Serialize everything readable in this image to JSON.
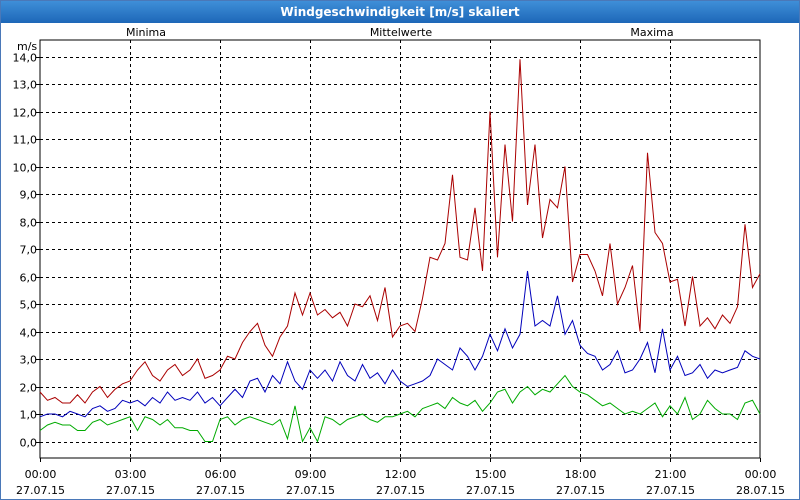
{
  "chart_data": {
    "type": "line",
    "title": "Windgeschwindigkeit [m/s] skaliert",
    "ylabel": "m/s",
    "ylim": [
      -0.6,
      14.6
    ],
    "xlim": [
      0,
      24
    ],
    "yticks": [
      "0,0",
      "1,0",
      "2,0",
      "3,0",
      "4,0",
      "5,0",
      "6,0",
      "7,0",
      "8,0",
      "9,0",
      "10,0",
      "11,0",
      "12,0",
      "13,0",
      "14,0"
    ],
    "xticks": [
      {
        "time": "00:00",
        "date": "27.07.15"
      },
      {
        "time": "03:00",
        "date": "27.07.15"
      },
      {
        "time": "06:00",
        "date": "27.07.15"
      },
      {
        "time": "09:00",
        "date": "27.07.15"
      },
      {
        "time": "12:00",
        "date": "27.07.15"
      },
      {
        "time": "15:00",
        "date": "27.07.15"
      },
      {
        "time": "18:00",
        "date": "27.07.15"
      },
      {
        "time": "21:00",
        "date": "27.07.15"
      },
      {
        "time": "00:00",
        "date": "28.07.15"
      }
    ],
    "grid": true,
    "legend_position": "top",
    "series": [
      {
        "name": "Minima",
        "color": "#00aa00",
        "x": [
          0,
          0.25,
          0.5,
          0.75,
          1,
          1.25,
          1.5,
          1.75,
          2,
          2.25,
          2.5,
          2.75,
          3,
          3.25,
          3.5,
          3.75,
          4,
          4.25,
          4.5,
          4.75,
          5,
          5.25,
          5.5,
          5.75,
          6,
          6.25,
          6.5,
          6.75,
          7,
          7.25,
          7.5,
          7.75,
          8,
          8.25,
          8.5,
          8.75,
          9,
          9.25,
          9.5,
          9.75,
          10,
          10.25,
          10.5,
          10.75,
          11,
          11.25,
          11.5,
          11.75,
          12,
          12.25,
          12.5,
          12.75,
          13,
          13.25,
          13.5,
          13.75,
          14,
          14.25,
          14.5,
          14.75,
          15,
          15.25,
          15.5,
          15.75,
          16,
          16.25,
          16.5,
          16.75,
          17,
          17.25,
          17.5,
          17.75,
          18,
          18.25,
          18.5,
          18.75,
          19,
          19.25,
          19.5,
          19.75,
          20,
          20.25,
          20.5,
          20.75,
          21,
          21.25,
          21.5,
          21.75,
          22,
          22.25,
          22.5,
          22.75,
          23,
          23.25,
          23.5,
          23.75,
          24
        ],
        "values": [
          0.4,
          0.6,
          0.7,
          0.6,
          0.6,
          0.4,
          0.4,
          0.7,
          0.8,
          0.6,
          0.7,
          0.8,
          0.9,
          0.4,
          0.9,
          0.8,
          0.6,
          0.8,
          0.5,
          0.5,
          0.4,
          0.4,
          0.0,
          0.0,
          0.8,
          0.9,
          0.6,
          0.8,
          0.9,
          0.8,
          0.7,
          0.6,
          0.8,
          0.1,
          1.3,
          0.0,
          0.5,
          0.0,
          0.9,
          0.8,
          0.6,
          0.8,
          0.9,
          1.0,
          0.8,
          0.7,
          0.9,
          0.9,
          1.0,
          1.1,
          0.9,
          1.2,
          1.3,
          1.4,
          1.2,
          1.6,
          1.4,
          1.3,
          1.5,
          1.1,
          1.4,
          1.8,
          1.9,
          1.4,
          1.8,
          2.0,
          1.7,
          1.9,
          1.8,
          2.1,
          2.4,
          2.0,
          1.8,
          1.7,
          1.5,
          1.3,
          1.4,
          1.2,
          1.0,
          1.1,
          1.0,
          1.2,
          1.4,
          0.9,
          1.3,
          1.0,
          1.6,
          0.8,
          1.0,
          1.5,
          1.2,
          1.0,
          1.0,
          0.8,
          1.4,
          1.5,
          1.0
        ]
      },
      {
        "name": "Mittelwerte",
        "color": "#0000bb",
        "x": [
          0,
          0.25,
          0.5,
          0.75,
          1,
          1.25,
          1.5,
          1.75,
          2,
          2.25,
          2.5,
          2.75,
          3,
          3.25,
          3.5,
          3.75,
          4,
          4.25,
          4.5,
          4.75,
          5,
          5.25,
          5.5,
          5.75,
          6,
          6.25,
          6.5,
          6.75,
          7,
          7.25,
          7.5,
          7.75,
          8,
          8.25,
          8.5,
          8.75,
          9,
          9.25,
          9.5,
          9.75,
          10,
          10.25,
          10.5,
          10.75,
          11,
          11.25,
          11.5,
          11.75,
          12,
          12.25,
          12.5,
          12.75,
          13,
          13.25,
          13.5,
          13.75,
          14,
          14.25,
          14.5,
          14.75,
          15,
          15.25,
          15.5,
          15.75,
          16,
          16.25,
          16.5,
          16.75,
          17,
          17.25,
          17.5,
          17.75,
          18,
          18.25,
          18.5,
          18.75,
          19,
          19.25,
          19.5,
          19.75,
          20,
          20.25,
          20.5,
          20.75,
          21,
          21.25,
          21.5,
          21.75,
          22,
          22.25,
          22.5,
          22.75,
          23,
          23.25,
          23.5,
          23.75,
          24
        ],
        "values": [
          0.9,
          1.0,
          1.0,
          0.9,
          1.1,
          1.0,
          0.9,
          1.2,
          1.3,
          1.1,
          1.2,
          1.5,
          1.4,
          1.5,
          1.3,
          1.6,
          1.4,
          1.8,
          1.5,
          1.6,
          1.5,
          1.8,
          1.4,
          1.6,
          1.3,
          1.6,
          1.9,
          1.6,
          2.2,
          2.3,
          1.8,
          2.4,
          2.1,
          2.9,
          2.2,
          1.9,
          2.6,
          2.3,
          2.6,
          2.2,
          2.9,
          2.4,
          2.2,
          2.8,
          2.3,
          2.5,
          2.1,
          2.6,
          2.2,
          2.0,
          2.1,
          2.2,
          2.4,
          3.0,
          2.8,
          2.6,
          3.4,
          3.1,
          2.6,
          3.1,
          3.9,
          3.3,
          4.1,
          3.4,
          3.9,
          6.2,
          4.2,
          4.4,
          4.2,
          5.3,
          3.9,
          4.4,
          3.5,
          3.2,
          3.1,
          2.6,
          2.8,
          3.3,
          2.5,
          2.6,
          3.0,
          3.6,
          2.5,
          4.1,
          2.6,
          3.1,
          2.4,
          2.5,
          2.8,
          2.3,
          2.6,
          2.5,
          2.6,
          2.7,
          3.3,
          3.1,
          3.0
        ]
      },
      {
        "name": "Maxima",
        "color": "#aa0000",
        "x": [
          0,
          0.25,
          0.5,
          0.75,
          1,
          1.25,
          1.5,
          1.75,
          2,
          2.25,
          2.5,
          2.75,
          3,
          3.25,
          3.5,
          3.75,
          4,
          4.25,
          4.5,
          4.75,
          5,
          5.25,
          5.5,
          5.75,
          6,
          6.25,
          6.5,
          6.75,
          7,
          7.25,
          7.5,
          7.75,
          8,
          8.25,
          8.5,
          8.75,
          9,
          9.25,
          9.5,
          9.75,
          10,
          10.25,
          10.5,
          10.75,
          11,
          11.25,
          11.5,
          11.75,
          12,
          12.25,
          12.5,
          12.75,
          13,
          13.25,
          13.5,
          13.75,
          14,
          14.25,
          14.5,
          14.75,
          15,
          15.25,
          15.5,
          15.75,
          16,
          16.25,
          16.5,
          16.75,
          17,
          17.25,
          17.5,
          17.75,
          18,
          18.25,
          18.5,
          18.75,
          19,
          19.25,
          19.5,
          19.75,
          20,
          20.25,
          20.5,
          20.75,
          21,
          21.25,
          21.5,
          21.75,
          22,
          22.25,
          22.5,
          22.75,
          23,
          23.25,
          23.5,
          23.75,
          24
        ],
        "values": [
          1.8,
          1.5,
          1.6,
          1.4,
          1.4,
          1.7,
          1.4,
          1.8,
          2.0,
          1.6,
          1.9,
          2.1,
          2.2,
          2.6,
          2.9,
          2.4,
          2.2,
          2.6,
          2.8,
          2.4,
          2.6,
          3.0,
          2.3,
          2.4,
          2.6,
          3.1,
          3.0,
          3.6,
          4.0,
          4.3,
          3.5,
          3.1,
          3.8,
          4.2,
          5.4,
          4.6,
          5.4,
          4.6,
          4.8,
          4.5,
          4.7,
          4.2,
          5.0,
          4.9,
          5.3,
          4.4,
          5.6,
          3.8,
          4.2,
          4.3,
          4.0,
          5.2,
          6.7,
          6.6,
          7.2,
          9.7,
          6.7,
          6.6,
          8.5,
          6.2,
          12.0,
          6.7,
          10.8,
          8.0,
          13.9,
          8.6,
          10.8,
          7.4,
          8.8,
          8.5,
          10.0,
          5.8,
          6.8,
          6.8,
          6.2,
          5.3,
          7.2,
          5.0,
          5.6,
          6.4,
          4.0,
          10.5,
          7.6,
          7.2,
          5.8,
          5.9,
          4.2,
          6.0,
          4.2,
          4.5,
          4.1,
          4.6,
          4.3,
          4.9,
          7.9,
          5.6,
          6.1
        ]
      }
    ]
  }
}
